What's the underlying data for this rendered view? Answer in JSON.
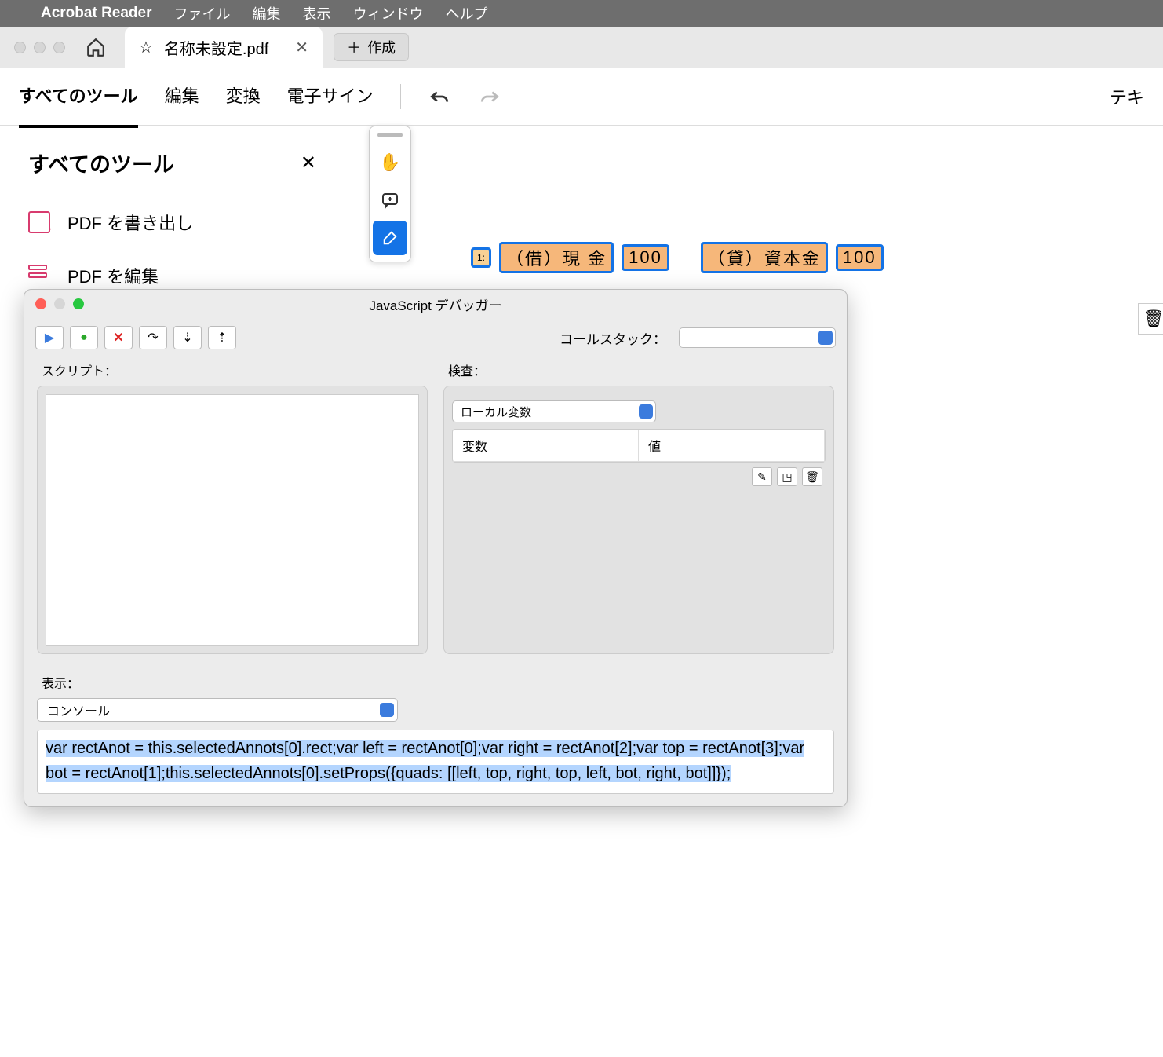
{
  "menubar": {
    "app": "Acrobat Reader",
    "items": [
      "ファイル",
      "編集",
      "表示",
      "ウィンドウ",
      "ヘルプ"
    ]
  },
  "tab": {
    "title": "名称未設定.pdf",
    "create": "作成"
  },
  "toolbar": {
    "all_tools": "すべてのツール",
    "edit": "編集",
    "convert": "変換",
    "sign": "電子サイン",
    "right": "テキ"
  },
  "sidebar": {
    "title": "すべてのツール",
    "export": "PDF を書き出し",
    "edit": "PDF を編集"
  },
  "pdf": {
    "marker": "1:",
    "left1": "（借）現 金",
    "left2": "100",
    "right1": "（貸）資本金",
    "right2": "100"
  },
  "debugger": {
    "title": "JavaScript デバッガー",
    "callstack_label": "コールスタック：",
    "script_label": "スクリプト：",
    "inspect_label": "検査：",
    "local_vars": "ローカル変数",
    "var_col": "変数",
    "val_col": "値",
    "view_label": "表示：",
    "view_select": "コンソール",
    "console": "var rectAnot = this.selectedAnnots[0].rect;var left = rectAnot[0];var right = rectAnot[2];var top = rectAnot[3];var bot = rectAnot[1];this.selectedAnnots[0].setProps({quads: [[left, top, right, top, left, bot, right, bot]]});"
  }
}
